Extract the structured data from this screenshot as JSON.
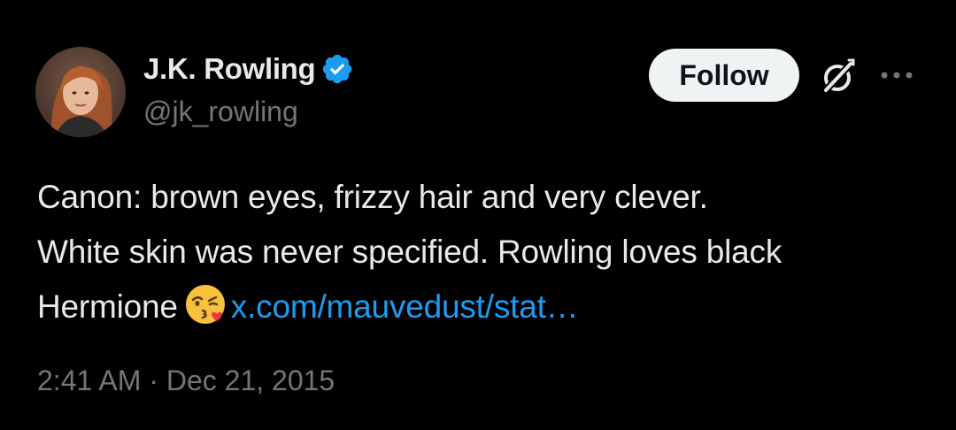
{
  "author": {
    "name": "J.K. Rowling",
    "handle": "@jk_rowling",
    "verified": true,
    "avatar_icon": "profile-photo"
  },
  "actions": {
    "follow_label": "Follow",
    "grok_icon": "grok-icon",
    "more_icon": "more-icon"
  },
  "tweet": {
    "line1": "Canon: brown eyes, frizzy hair and very clever.",
    "line2": "White skin was never specified. Rowling loves black",
    "line3_text": "Hermione",
    "emoji": "face-throwing-a-kiss",
    "link_text": "x.com/mauvedust/stat…"
  },
  "timestamp": {
    "time": "2:41 AM",
    "separator": "·",
    "date": "Dec 21, 2015"
  },
  "colors": {
    "background": "#000000",
    "text_primary": "#e7e9ea",
    "text_secondary": "#71767b",
    "link": "#1d9bf0",
    "verified_badge": "#1d9bf0",
    "follow_bg": "#eff3f4"
  }
}
